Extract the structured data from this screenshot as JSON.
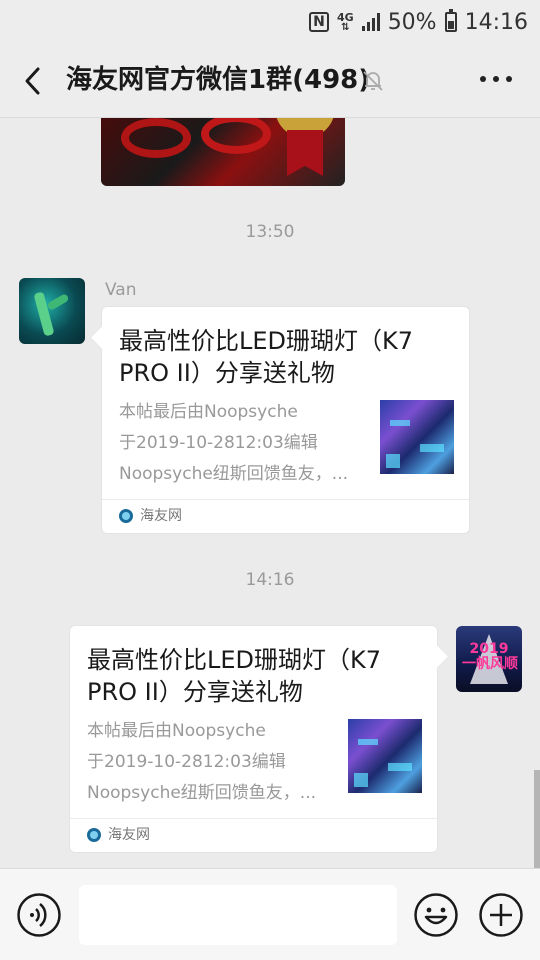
{
  "status_bar": {
    "nfc_label": "N",
    "network": "4G",
    "battery_percent": "50%",
    "battery_level": 0.5,
    "time": "14:16"
  },
  "header": {
    "title": "海友网官方微信1群(498)",
    "back_icon": "chevron-left-icon",
    "mute_icon": "bell-muted-icon",
    "more_icon": "more-dots-icon"
  },
  "chat": {
    "messages": [
      {
        "type": "image",
        "direction": "incoming"
      },
      {
        "type": "timestamp",
        "text": "13:50"
      },
      {
        "type": "link-card",
        "direction": "incoming",
        "sender": "Van",
        "title": "最高性价比LED珊瑚灯（K7 PRO II）分享送礼物",
        "desc_lines": [
          "本帖最后由Noopsyche",
          "于2019-10-2812:03编辑",
          "Noopsyche纽斯回馈鱼友，..."
        ],
        "source": "海友网"
      },
      {
        "type": "timestamp",
        "text": "14:16"
      },
      {
        "type": "link-card",
        "direction": "outgoing",
        "title": "最高性价比LED珊瑚灯（K7 PRO II）分享送礼物",
        "desc_lines": [
          "本帖最后由Noopsyche",
          "于2019-10-2812:03编辑",
          "Noopsyche纽斯回馈鱼友，..."
        ],
        "source": "海友网"
      }
    ],
    "my_avatar_text": "2019\n一帆风顺"
  },
  "input_bar": {
    "voice_icon": "voice-icon",
    "emoji_icon": "emoji-icon",
    "plus_icon": "plus-icon",
    "input_value": ""
  }
}
